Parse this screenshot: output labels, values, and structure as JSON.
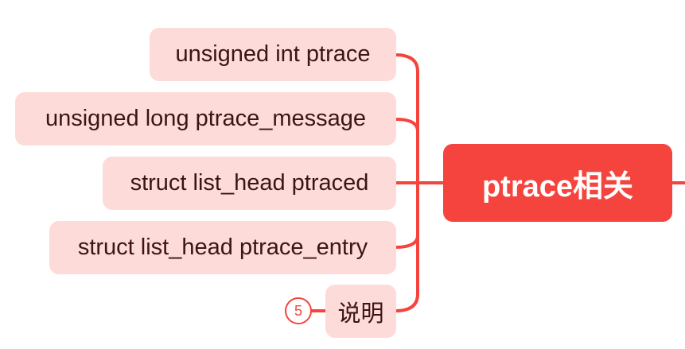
{
  "root": {
    "label": "ptrace相关"
  },
  "children": [
    {
      "label": "unsigned int ptrace"
    },
    {
      "label": "unsigned long ptrace_message"
    },
    {
      "label": "struct list_head ptraced"
    },
    {
      "label": "struct list_head ptrace_entry"
    },
    {
      "label": "说明",
      "badge": "5"
    }
  ],
  "colors": {
    "root_fill": "#f5433d",
    "child_fill": "#fddbd8",
    "connector": "#f5433d",
    "child_text": "#3d1414"
  }
}
